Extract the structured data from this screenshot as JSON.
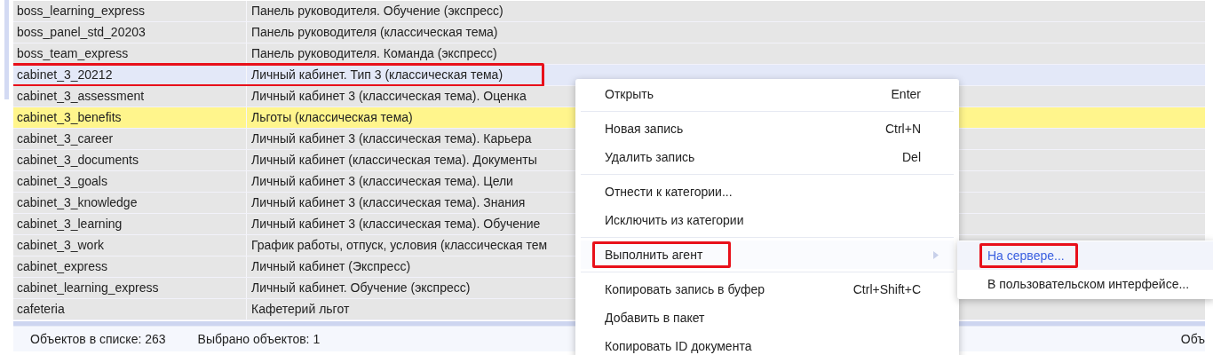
{
  "table": {
    "rows": [
      {
        "name": "boss_learning_express",
        "title": "Панель руководителя. Обучение (экспресс)",
        "selected": false,
        "flagged": false,
        "highlighted": false
      },
      {
        "name": "boss_panel_std_20203",
        "title": "Панель руководителя (классическая тема)",
        "selected": false,
        "flagged": false,
        "highlighted": false
      },
      {
        "name": "boss_team_express",
        "title": "Панель руководителя. Команда (экспресс)",
        "selected": false,
        "flagged": false,
        "highlighted": false
      },
      {
        "name": "cabinet_3_20212",
        "title": "Личный кабинет. Тип 3 (классическая тема)",
        "selected": true,
        "flagged": false,
        "highlighted": true
      },
      {
        "name": "cabinet_3_assessment",
        "title": "Личный кабинет 3 (классическая тема). Оценка",
        "selected": false,
        "flagged": false,
        "highlighted": false
      },
      {
        "name": "cabinet_3_benefits",
        "title": "Льготы (классическая тема)",
        "selected": false,
        "flagged": true,
        "highlighted": false
      },
      {
        "name": "cabinet_3_career",
        "title": "Личный кабинет 3 (классическая тема). Карьера",
        "selected": false,
        "flagged": false,
        "highlighted": false
      },
      {
        "name": "cabinet_3_documents",
        "title": "Личный кабинет (классическая тема). Документы",
        "selected": false,
        "flagged": false,
        "highlighted": false
      },
      {
        "name": "cabinet_3_goals",
        "title": "Личный кабинет 3 (классическая тема). Цели",
        "selected": false,
        "flagged": false,
        "highlighted": false
      },
      {
        "name": "cabinet_3_knowledge",
        "title": "Личный кабинет 3 (классическая тема). Знания",
        "selected": false,
        "flagged": false,
        "highlighted": false
      },
      {
        "name": "cabinet_3_learning",
        "title": "Личный кабинет 3 (классическая тема). Обучение",
        "selected": false,
        "flagged": false,
        "highlighted": false
      },
      {
        "name": "cabinet_3_work",
        "title": "График работы, отпуск, условия (классическая тем",
        "selected": false,
        "flagged": false,
        "highlighted": false
      },
      {
        "name": "cabinet_express",
        "title": "Личный кабинет (Экспресс)",
        "selected": false,
        "flagged": false,
        "highlighted": false
      },
      {
        "name": "cabinet_learning_express",
        "title": "Личный кабинет. Обучение (экспресс)",
        "selected": false,
        "flagged": false,
        "highlighted": false
      },
      {
        "name": "cafeteria",
        "title": "Кафетерий льгот",
        "selected": false,
        "flagged": false,
        "highlighted": false
      }
    ]
  },
  "status_bar": {
    "count": "Объектов в списке: 263",
    "selected": "Выбрано объектов: 1",
    "right": "Объ"
  },
  "context_menu": {
    "items": [
      {
        "kind": "item",
        "label": "Открыть",
        "shortcut": "Enter"
      },
      {
        "kind": "separator"
      },
      {
        "kind": "item",
        "label": "Новая запись",
        "shortcut": "Ctrl+N"
      },
      {
        "kind": "item",
        "label": "Удалить запись",
        "shortcut": "Del"
      },
      {
        "kind": "separator"
      },
      {
        "kind": "item",
        "label": "Отнести к категории..."
      },
      {
        "kind": "item",
        "label": "Исключить из категории"
      },
      {
        "kind": "separator"
      },
      {
        "kind": "submenu",
        "label": "Выполнить агент",
        "highlighted": true,
        "expanded": true
      },
      {
        "kind": "separator"
      },
      {
        "kind": "item",
        "label": "Копировать запись в буфер",
        "shortcut": "Ctrl+Shift+C"
      },
      {
        "kind": "item",
        "label": "Добавить в пакет"
      },
      {
        "kind": "item",
        "label": "Копировать ID документа"
      }
    ]
  },
  "submenu": {
    "items": [
      {
        "label": "На сервере...",
        "selected": true,
        "highlighted": true
      },
      {
        "label": "В пользовательском интерфейсе...",
        "selected": false,
        "highlighted": false
      }
    ]
  }
}
